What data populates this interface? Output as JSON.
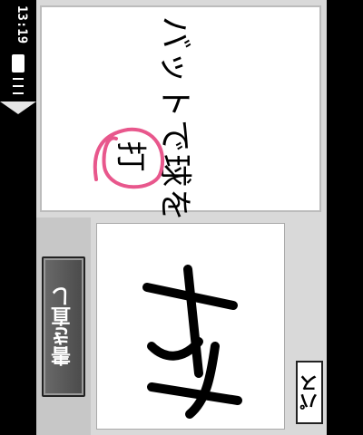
{
  "status_bar": {
    "time": "13:19",
    "battery_icon": "battery-icon",
    "signal_icon": "signal-icon"
  },
  "question": {
    "text": "バットで球をうつ",
    "circled_char": "打",
    "highlight_color": "#e8578c"
  },
  "buttons": {
    "rewrite_label": "書き直し",
    "pass_label": "パス"
  },
  "write_panel": {
    "drawn_char": "打"
  }
}
